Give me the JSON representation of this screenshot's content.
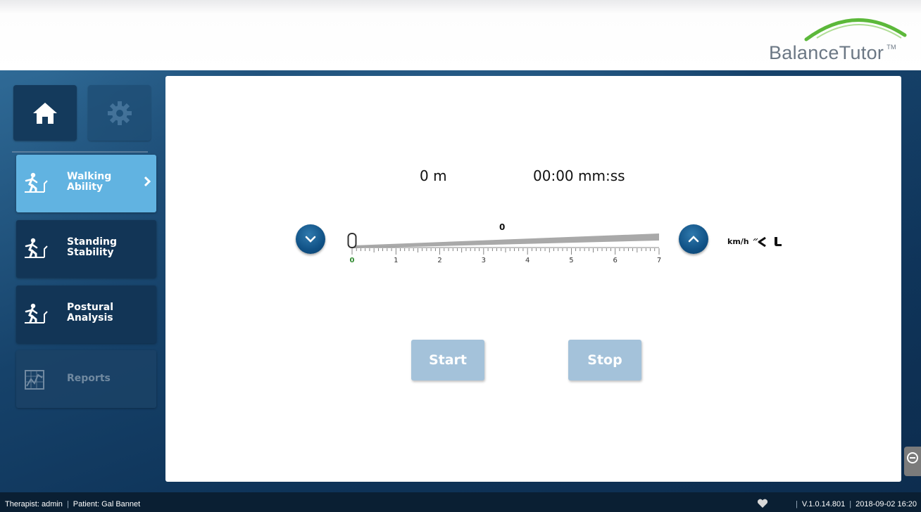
{
  "app": {
    "brand": "BalanceTutor",
    "trademark": "TM",
    "brand_color": "#6b7784",
    "logo_arc_color": "#5cb83a"
  },
  "sidebar": {
    "home_icon": "home-icon",
    "settings_icon": "gear-icon",
    "items": [
      {
        "label_line1": "Walking",
        "label_line2": "Ability",
        "icon": "treadmill-walker-icon",
        "active": true
      },
      {
        "label_line1": "Standing",
        "label_line2": "Stability",
        "icon": "treadmill-walker-icon",
        "active": false
      },
      {
        "label_line1": "Postural",
        "label_line2": "Analysis",
        "icon": "treadmill-walker-icon",
        "active": false
      },
      {
        "label_line1": "Reports",
        "label_line2": "",
        "icon": "chart-icon",
        "active": false,
        "disabled": true
      }
    ],
    "active_color": "#61b3e1"
  },
  "main": {
    "distance": "0 m",
    "duration": "00:00 mm:ss",
    "speed": {
      "value": "0",
      "min": 0,
      "max": 7,
      "current": 0,
      "ticks": [
        "0",
        "1",
        "2",
        "3",
        "4",
        "5",
        "6",
        "7"
      ],
      "unit": "km/h",
      "decrease_icon": "chevron-down-icon",
      "increase_icon": "chevron-up-icon",
      "direction_icon": "backward-arrow-icon",
      "boot_icon": "boot-icon"
    },
    "start_label": "Start",
    "stop_label": "Stop",
    "button_color": "#a4c2da"
  },
  "status": {
    "therapist": "Therapist: admin",
    "patient": "Patient: Gal Bannet",
    "version": "V.1.0.14.801",
    "datetime": "2018-09-02 16:20",
    "heart_icon": "heart-icon"
  }
}
